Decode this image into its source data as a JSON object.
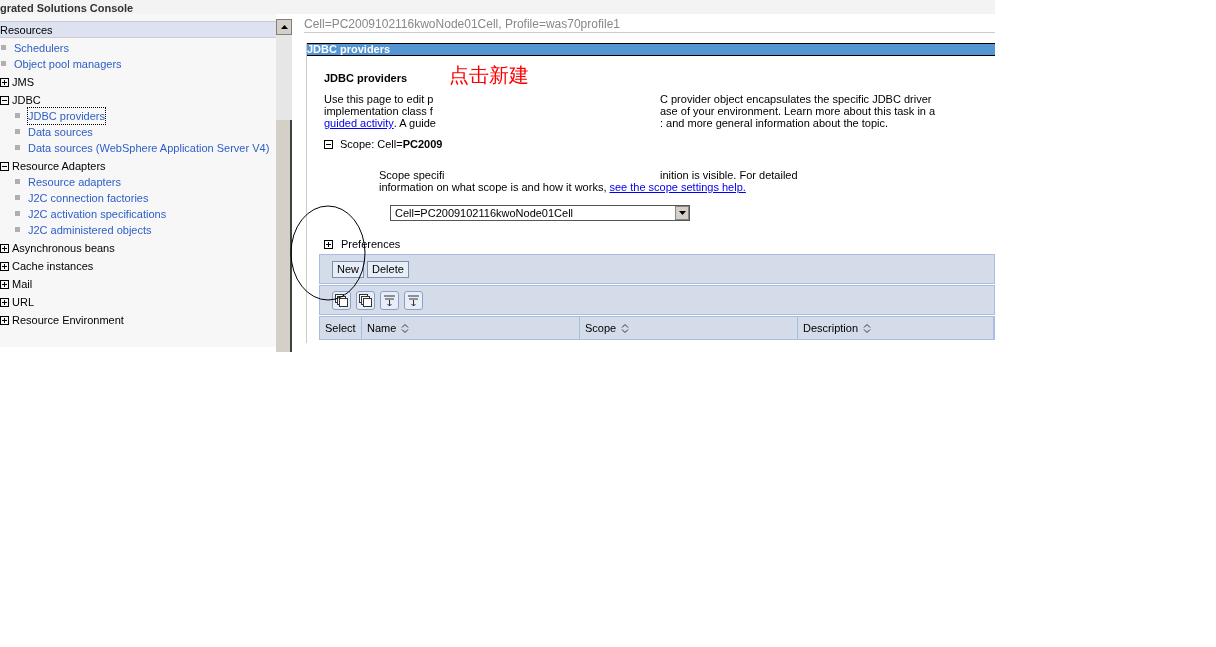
{
  "console_header": {
    "title": "grated Solutions Console"
  },
  "sidebar": {
    "header": "Resources",
    "items": [
      {
        "kind": "link",
        "label": "Schedulers",
        "selected": false
      },
      {
        "kind": "link",
        "label": "Object pool managers",
        "selected": false
      },
      {
        "kind": "group",
        "label": "JMS",
        "expanded": false
      },
      {
        "kind": "group",
        "label": "JDBC",
        "expanded": true,
        "children": [
          {
            "label": "JDBC providers",
            "selected": true
          },
          {
            "label": "Data sources",
            "selected": false
          },
          {
            "label": "Data sources (WebSphere Application Server V4)",
            "selected": false
          }
        ]
      },
      {
        "kind": "group",
        "label": "Resource Adapters",
        "expanded": true,
        "children": [
          {
            "label": "Resource adapters",
            "selected": false
          },
          {
            "label": "J2C connection factories",
            "selected": false
          },
          {
            "label": "J2C activation specifications",
            "selected": false
          },
          {
            "label": "J2C administered objects",
            "selected": false
          }
        ]
      },
      {
        "kind": "group",
        "label": "Asynchronous beans",
        "expanded": false
      },
      {
        "kind": "group",
        "label": "Cache instances",
        "expanded": false
      },
      {
        "kind": "group",
        "label": "Mail",
        "expanded": false
      },
      {
        "kind": "group",
        "label": "URL",
        "expanded": false
      },
      {
        "kind": "group",
        "label": "Resource Environment",
        "expanded": false
      }
    ]
  },
  "breadcrumb": "Cell=PC2009102116kwoNode01Cell, Profile=was70profile1",
  "panel": {
    "title": "JDBC providers",
    "heading": "JDBC providers",
    "annotation": "点击新建",
    "description": [
      {
        "left": "Use this page to edit p",
        "right": "C provider object encapsulates the specific JDBC driver"
      },
      {
        "left": "implementation class f",
        "right": "ase of your environment. Learn more about this task in a"
      },
      {
        "link": "guided activity",
        "left": ". A guide",
        "right": ": and more general information about the topic."
      }
    ],
    "scope": {
      "expanded": true,
      "label": "Scope: Cell=**PC2009**",
      "text_left": "Scope specifi",
      "text_right": "inition is visible. For detailed",
      "text_line2": "information on what scope is and how it works, ",
      "help_link": "see the scope settings help.",
      "select_value": "Cell=PC2009102116kwoNode01Cell"
    },
    "preferences": {
      "label": "Preferences",
      "expanded": false
    },
    "buttons": [
      "New",
      "Delete"
    ],
    "columns": [
      "Select",
      "Name",
      "Scope",
      "Description"
    ]
  }
}
